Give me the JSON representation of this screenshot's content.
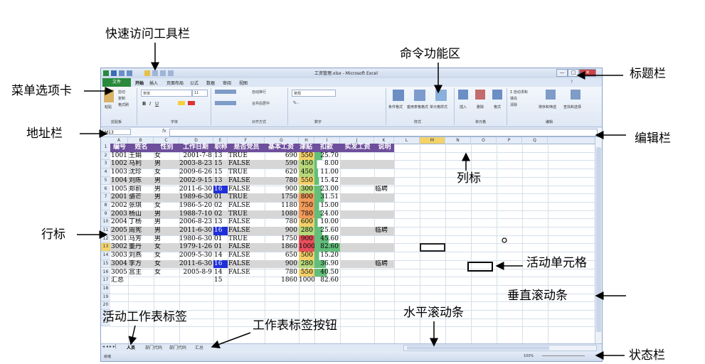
{
  "callouts": {
    "qat": "快速访问工具栏",
    "ribbon": "命令功能区",
    "menu_tab": "菜单选项卡",
    "title_bar": "标题栏",
    "address_bar": "地址栏",
    "edit_bar": "编辑栏",
    "col_label": "列标",
    "row_label": "行标",
    "active_cell": "活动单元格",
    "vscroll": "垂直滚动条",
    "active_sheet_tab": "活动工作表标签",
    "sheet_tab_buttons": "工作表标签按钮",
    "hscroll": "水平滚动条",
    "status_bar": "状态栏"
  },
  "excel": {
    "title": "工资管理.xlsx - Microsoft Excel",
    "window_buttons": [
      "—",
      "□",
      "✕"
    ],
    "tabs": [
      "文件",
      "开始",
      "插入",
      "页面布局",
      "公式",
      "数据",
      "审阅",
      "视图"
    ],
    "ribbon": {
      "clipboard": {
        "paste": "粘贴",
        "cut": "剪切",
        "copy": "复制",
        "format_painter": "格式刷",
        "group": "剪贴板"
      },
      "font": {
        "name": "宋体",
        "size": "11",
        "group": "字体"
      },
      "align": {
        "wrap": "自动换行",
        "merge": "合并后居中",
        "group": "对齐方式"
      },
      "number": {
        "format": "常规",
        "group": "数字"
      },
      "styles": {
        "cond": "条件格式",
        "table": "套用表格格式",
        "cell": "单元格样式",
        "group": "样式"
      },
      "cells": {
        "insert": "插入",
        "delete": "删除",
        "format": "格式",
        "group": "单元格"
      },
      "editing": {
        "autosum": "Σ 自动求和",
        "fill": "填充",
        "clear": "清除",
        "sort": "排序和筛选",
        "find": "查找和选择",
        "group": "编辑"
      }
    },
    "name_box": "M13",
    "fx": "fx",
    "columns": [
      "A",
      "B",
      "C",
      "D",
      "E",
      "F",
      "G",
      "H",
      "I",
      "J",
      "K",
      "L",
      "M",
      "N",
      "O",
      "P",
      "Q"
    ],
    "rows": [
      "1",
      "2",
      "3",
      "4",
      "5",
      "6",
      "7",
      "8",
      "9",
      "10",
      "11",
      "12",
      "13",
      "14",
      "15",
      "16",
      "17",
      "18",
      "19",
      "20",
      "21",
      "22"
    ],
    "headers": [
      "编号",
      "姓名",
      "性别",
      "工作日期",
      "职称",
      "是否党员",
      "基本工资",
      "津贴",
      "扣款",
      "实发工资",
      "说明"
    ],
    "data": [
      [
        "1001",
        "王娟",
        "女",
        "2001-7-8",
        "13",
        "TRUE",
        "690",
        "550",
        "25.70",
        "",
        ""
      ],
      [
        "1002",
        "马利",
        "男",
        "2003-8-23",
        "15",
        "FALSE",
        "590",
        "450",
        "8.00",
        "",
        ""
      ],
      [
        "1003",
        "沈珍",
        "女",
        "2009-6-26",
        "15",
        "TRUE",
        "620",
        "450",
        "11.00",
        "",
        ""
      ],
      [
        "1004",
        "刘陈",
        "男",
        "2002-9-15",
        "13",
        "FALSE",
        "780",
        "550",
        "15.42",
        "",
        ""
      ],
      [
        "1005",
        "郑前",
        "男",
        "2011-6-30",
        "16",
        "FALSE",
        "900",
        "300",
        "23.00",
        "",
        "临聘"
      ],
      [
        "2001",
        "骆芒",
        "男",
        "1989-6-30",
        "01",
        "TRUE",
        "1750",
        "800",
        "31.51",
        "",
        ""
      ],
      [
        "2002",
        "张琪",
        "女",
        "1986-5-20",
        "02",
        "FALSE",
        "1180",
        "750",
        "15.00",
        "",
        ""
      ],
      [
        "2003",
        "杨山",
        "男",
        "1988-7-10",
        "02",
        "TRUE",
        "1080",
        "780",
        "24.00",
        "",
        ""
      ],
      [
        "2004",
        "丁杨",
        "男",
        "2006-8-23",
        "13",
        "FALSE",
        "780",
        "600",
        "10.00",
        "",
        ""
      ],
      [
        "2005",
        "周宪",
        "男",
        "2011-6-30",
        "16",
        "FALSE",
        "900",
        "280",
        "25.60",
        "",
        "临聘"
      ],
      [
        "3001",
        "马芳",
        "男",
        "1980-6-30",
        "01",
        "TRUE",
        "1750",
        "900",
        "45.60",
        "",
        ""
      ],
      [
        "3002",
        "董丹",
        "女",
        "1979-1-26",
        "01",
        "FALSE",
        "1860",
        "1000",
        "82.60",
        "",
        ""
      ],
      [
        "3003",
        "刘燕",
        "女",
        "2009-5-30",
        "14",
        "FALSE",
        "650",
        "500",
        "15.20",
        "",
        ""
      ],
      [
        "3004",
        "李方",
        "女",
        "2011-6-30",
        "16",
        "FALSE",
        "900",
        "280",
        "36.90",
        "",
        "临聘"
      ],
      [
        "3005",
        "宫主",
        "女",
        "2005-8-9",
        "14",
        "FALSE",
        "780",
        "550",
        "40.50",
        "",
        ""
      ]
    ],
    "total_row": [
      "汇总",
      "",
      "",
      "",
      "15",
      "",
      "1860",
      "1000",
      "82.60",
      "",
      ""
    ],
    "sheet_tabs": [
      "人员",
      "部门代码",
      "部门代码",
      "汇总"
    ],
    "status": "就绪",
    "zoom": "100%"
  }
}
